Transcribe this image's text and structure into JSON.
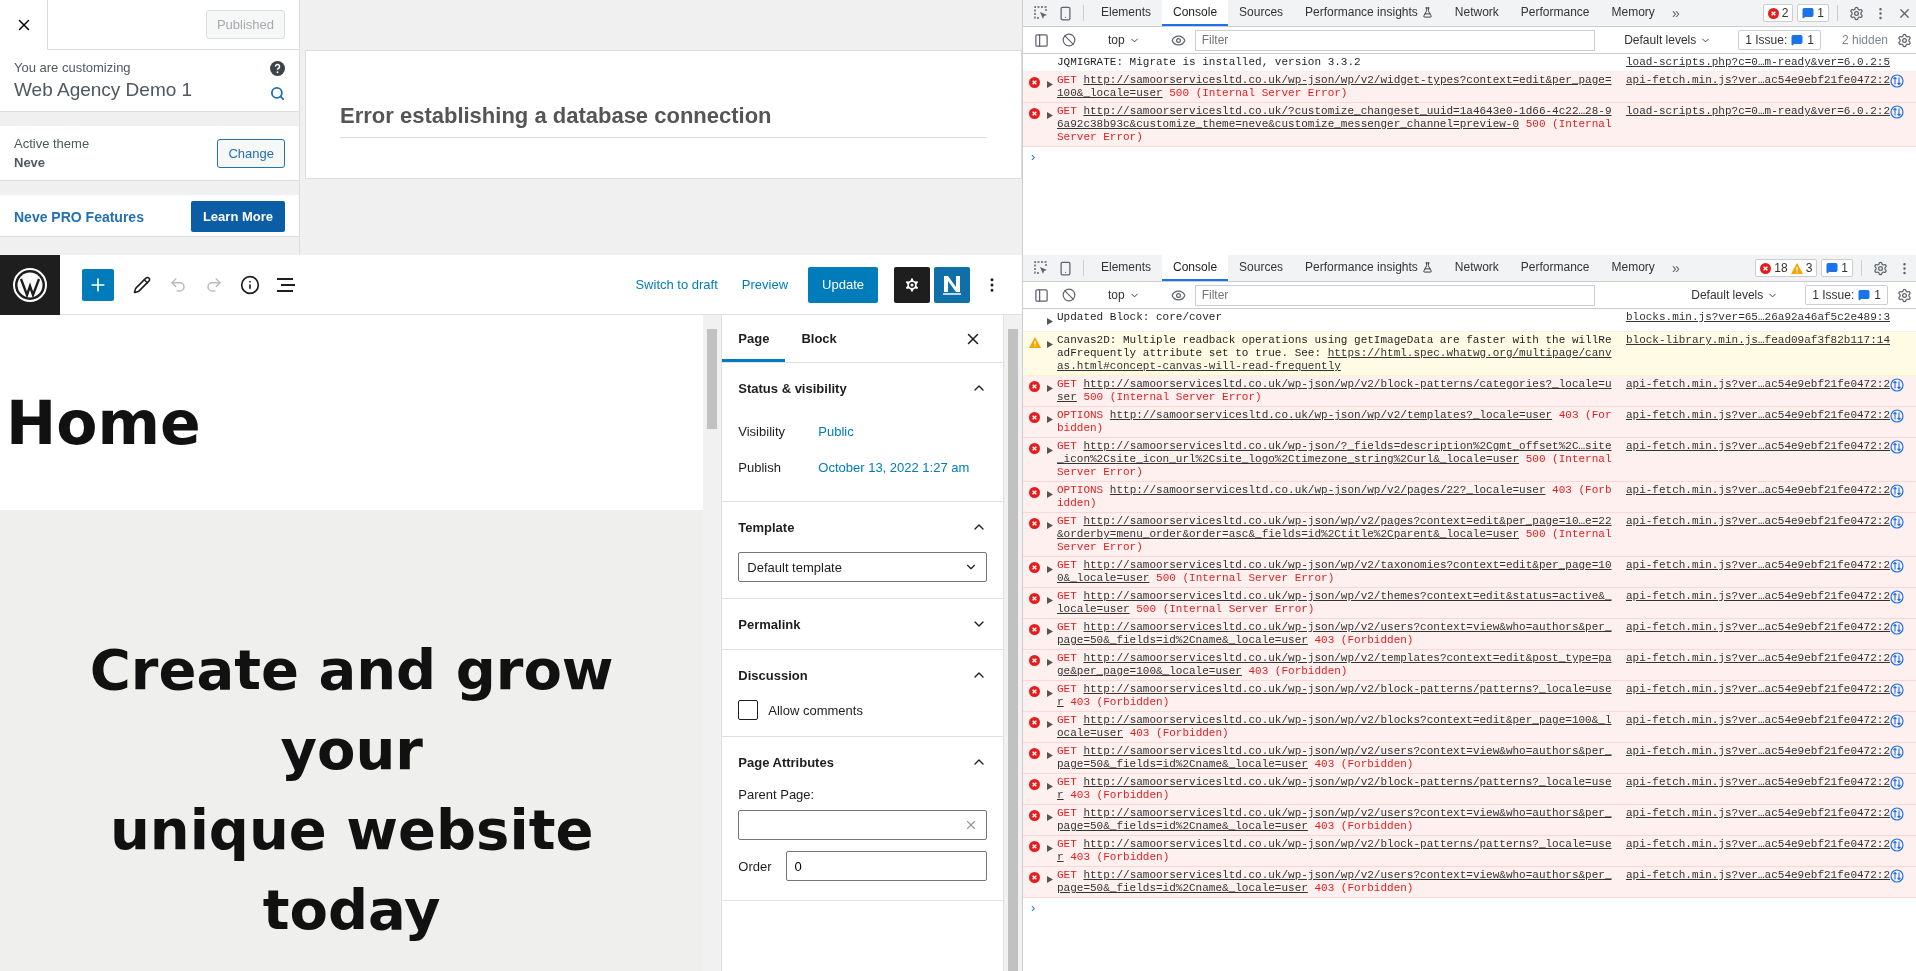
{
  "customizer": {
    "status_button": "Published",
    "customizing_label": "You are customizing",
    "site_name": "Web Agency Demo 1",
    "theme_label": "Active theme",
    "theme_name": "Neve",
    "change_button": "Change",
    "promo_title": "Neve PRO Features",
    "promo_button": "Learn More"
  },
  "preview": {
    "error_title": "Error establishing a database connection"
  },
  "editor": {
    "toolbar": {
      "switch_to_draft": "Switch to draft",
      "preview": "Preview",
      "update": "Update"
    },
    "canvas": {
      "title": "Home",
      "cover_lines": [
        "Create and grow",
        "your",
        "unique website",
        "today"
      ]
    },
    "sidebar": {
      "tabs": [
        {
          "label": "Page",
          "selected": true
        },
        {
          "label": "Block",
          "selected": false
        }
      ],
      "panels": [
        {
          "kind": "status",
          "title": "Status & visibility",
          "expanded": true,
          "rows": [
            {
              "label": "Visibility",
              "value": "Public"
            },
            {
              "label": "Publish",
              "value": "October 13, 2022 1:27 am"
            }
          ]
        },
        {
          "kind": "template",
          "title": "Template",
          "expanded": true,
          "select_value": "Default template"
        },
        {
          "kind": "plain",
          "title": "Permalink",
          "expanded": false
        },
        {
          "kind": "discussion",
          "title": "Discussion",
          "expanded": true,
          "options": [
            {
              "label": "Allow comments",
              "checked": false
            }
          ]
        },
        {
          "kind": "attributes",
          "title": "Page Attributes",
          "expanded": true,
          "parent_label": "Parent Page:",
          "order_label": "Order",
          "order_value": "0"
        }
      ]
    }
  },
  "devtools": [
    {
      "closable": true,
      "prompt": "›",
      "tabs": [
        {
          "label": "Elements",
          "selected": false
        },
        {
          "label": "Console",
          "selected": true
        },
        {
          "label": "Sources",
          "selected": false
        },
        {
          "label": "Performance insights",
          "selected": false
        },
        {
          "label": "Network",
          "selected": false
        },
        {
          "label": "Performance",
          "selected": false
        },
        {
          "label": "Memory",
          "selected": false
        }
      ],
      "overflow": "»",
      "errors": "2",
      "messages_count": "1",
      "context": "top",
      "filter_placeholder": "Filter",
      "levels": "Default levels",
      "issues_label": "1 Issue:",
      "issues_count": "1",
      "hidden": "2 hidden",
      "messages": [
        {
          "kind": "info",
          "expandable": false,
          "text": "JQMIGRATE: Migrate is installed, version 3.3.2",
          "source": "load-scripts.php?c=0…m-ready&ver=6.0.2:5"
        },
        {
          "kind": "error",
          "expandable": true,
          "method": "GET",
          "url": "http://samoorservicesltd.co.uk/wp-json/wp/v2/widget-types?context=edit&per_page=100&_locale=user",
          "status": "500 (Internal Server Error)",
          "source": "api-fetch.min.js?ver…ac54e9ebf21fe0472:2"
        },
        {
          "kind": "error",
          "expandable": true,
          "method": "GET",
          "url": "http://samoorservicesltd.co.uk/?customize_changeset_uuid=1a4643e0-1d66-4c22…28-96a92c38b93c&customize_theme=neve&customize_messenger_channel=preview-0",
          "status": "500 (Internal Server Error)",
          "source": "load-scripts.php?c=0…m-ready&ver=6.0.2:2"
        }
      ]
    },
    {
      "closable": false,
      "prompt": "›",
      "tabs": [
        {
          "label": "Elements",
          "selected": false
        },
        {
          "label": "Console",
          "selected": true
        },
        {
          "label": "Sources",
          "selected": false
        },
        {
          "label": "Performance insights",
          "selected": false
        },
        {
          "label": "Network",
          "selected": false
        },
        {
          "label": "Performance",
          "selected": false
        },
        {
          "label": "Memory",
          "selected": false
        }
      ],
      "overflow": "»",
      "errors": "18",
      "warnings": "3",
      "messages_count": "1",
      "context": "top",
      "filter_placeholder": "Filter",
      "levels": "Default levels",
      "issues_label": "1 Issue:",
      "issues_count": "1",
      "messages": [
        {
          "kind": "info",
          "expandable": true,
          "text": "Updated Block: core/cover",
          "source": "blocks.min.js?ver=65…26a92a46af5c2e489:3"
        },
        {
          "kind": "warning",
          "expandable": true,
          "text": "Canvas2D: Multiple readback operations using getImageData are faster with the willReadFrequently attribute set to true. See:",
          "url": "https://html.spec.whatwg.org/multipage/canvas.html#concept-canvas-will-read-frequently",
          "source": "block-library.min.js…fead09af3f82b117:14"
        },
        {
          "kind": "error",
          "expandable": true,
          "method": "GET",
          "url": "http://samoorservicesltd.co.uk/wp-json/wp/v2/block-patterns/categories?_locale=user",
          "status": "500 (Internal Server Error)",
          "source": "api-fetch.min.js?ver…ac54e9ebf21fe0472:2"
        },
        {
          "kind": "error",
          "expandable": true,
          "method": "OPTIONS",
          "url": "http://samoorservicesltd.co.uk/wp-json/wp/v2/templates?_locale=user",
          "status": "403 (Forbidden)",
          "source": "api-fetch.min.js?ver…ac54e9ebf21fe0472:2"
        },
        {
          "kind": "error",
          "expandable": true,
          "method": "GET",
          "url": "http://samoorservicesltd.co.uk/wp-json/?_fields=description%2Cgmt_offset%2C…site_icon%2Csite_icon_url%2Csite_logo%2Ctimezone_string%2Curl&_locale=user",
          "status": "500 (Internal Server Error)",
          "source": "api-fetch.min.js?ver…ac54e9ebf21fe0472:2"
        },
        {
          "kind": "error",
          "expandable": true,
          "method": "OPTIONS",
          "url": "http://samoorservicesltd.co.uk/wp-json/wp/v2/pages/22?_locale=user",
          "status": "403 (Forbidden)",
          "source": "api-fetch.min.js?ver…ac54e9ebf21fe0472:2"
        },
        {
          "kind": "error",
          "expandable": true,
          "method": "GET",
          "url": "http://samoorservicesltd.co.uk/wp-json/wp/v2/pages?context=edit&per_page=10…e=22&orderby=menu_order&order=asc&_fields=id%2Ctitle%2Cparent&_locale=user",
          "status": "500 (Internal Server Error)",
          "source": "api-fetch.min.js?ver…ac54e9ebf21fe0472:2"
        },
        {
          "kind": "error",
          "expandable": true,
          "method": "GET",
          "url": "http://samoorservicesltd.co.uk/wp-json/wp/v2/taxonomies?context=edit&per_page=100&_locale=user",
          "status": "500 (Internal Server Error)",
          "source": "api-fetch.min.js?ver…ac54e9ebf21fe0472:2"
        },
        {
          "kind": "error",
          "expandable": true,
          "method": "GET",
          "url": "http://samoorservicesltd.co.uk/wp-json/wp/v2/themes?context=edit&status=active&_locale=user",
          "status": "500 (Internal Server Error)",
          "source": "api-fetch.min.js?ver…ac54e9ebf21fe0472:2"
        },
        {
          "kind": "error",
          "expandable": true,
          "method": "GET",
          "url": "http://samoorservicesltd.co.uk/wp-json/wp/v2/users?context=view&who=authors&per_page=50&_fields=id%2Cname&_locale=user",
          "status": "403 (Forbidden)",
          "source": "api-fetch.min.js?ver…ac54e9ebf21fe0472:2"
        },
        {
          "kind": "error",
          "expandable": true,
          "method": "GET",
          "url": "http://samoorservicesltd.co.uk/wp-json/wp/v2/templates?context=edit&post_type=page&per_page=100&_locale=user",
          "status": "403 (Forbidden)",
          "source": "api-fetch.min.js?ver…ac54e9ebf21fe0472:2"
        },
        {
          "kind": "error",
          "expandable": true,
          "method": "GET",
          "url": "http://samoorservicesltd.co.uk/wp-json/wp/v2/block-patterns/patterns?_locale=user",
          "status": "403 (Forbidden)",
          "source": "api-fetch.min.js?ver…ac54e9ebf21fe0472:2"
        },
        {
          "kind": "error",
          "expandable": true,
          "method": "GET",
          "url": "http://samoorservicesltd.co.uk/wp-json/wp/v2/blocks?context=edit&per_page=100&_locale=user",
          "status": "403 (Forbidden)",
          "source": "api-fetch.min.js?ver…ac54e9ebf21fe0472:2"
        },
        {
          "kind": "error",
          "expandable": true,
          "method": "GET",
          "url": "http://samoorservicesltd.co.uk/wp-json/wp/v2/users?context=view&who=authors&per_page=50&_fields=id%2Cname&_locale=user",
          "status": "403 (Forbidden)",
          "source": "api-fetch.min.js?ver…ac54e9ebf21fe0472:2"
        },
        {
          "kind": "error",
          "expandable": true,
          "method": "GET",
          "url": "http://samoorservicesltd.co.uk/wp-json/wp/v2/block-patterns/patterns?_locale=user",
          "status": "403 (Forbidden)",
          "source": "api-fetch.min.js?ver…ac54e9ebf21fe0472:2"
        },
        {
          "kind": "error",
          "expandable": true,
          "method": "GET",
          "url": "http://samoorservicesltd.co.uk/wp-json/wp/v2/users?context=view&who=authors&per_page=50&_fields=id%2Cname&_locale=user",
          "status": "403 (Forbidden)",
          "source": "api-fetch.min.js?ver…ac54e9ebf21fe0472:2"
        },
        {
          "kind": "error",
          "expandable": true,
          "method": "GET",
          "url": "http://samoorservicesltd.co.uk/wp-json/wp/v2/block-patterns/patterns?_locale=user",
          "status": "403 (Forbidden)",
          "source": "api-fetch.min.js?ver…ac54e9ebf21fe0472:2"
        },
        {
          "kind": "error",
          "expandable": true,
          "method": "GET",
          "url": "http://samoorservicesltd.co.uk/wp-json/wp/v2/users?context=view&who=authors&per_page=50&_fields=id%2Cname&_locale=user",
          "status": "403 (Forbidden)",
          "source": "api-fetch.min.js?ver…ac54e9ebf21fe0472:2"
        }
      ]
    }
  ]
}
